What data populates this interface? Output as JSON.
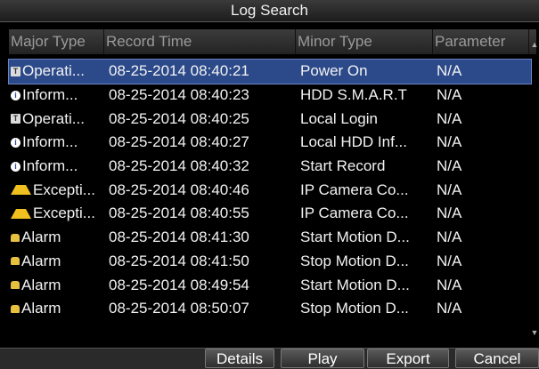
{
  "window": {
    "title": "Log Search"
  },
  "table": {
    "headers": [
      "Major Type",
      "Record Time",
      "Minor Type",
      "Parameter"
    ],
    "rows": [
      {
        "icon": "operation-icon",
        "major": "Operati...",
        "time": "08-25-2014 08:40:21",
        "minor": "Power On",
        "param": "N/A",
        "selected": true
      },
      {
        "icon": "information-icon",
        "major": "Inform...",
        "time": "08-25-2014 08:40:23",
        "minor": "HDD S.M.A.R.T",
        "param": "N/A"
      },
      {
        "icon": "operation-icon",
        "major": "Operati...",
        "time": "08-25-2014 08:40:25",
        "minor": "Local Login",
        "param": "N/A"
      },
      {
        "icon": "information-icon",
        "major": "Inform...",
        "time": "08-25-2014 08:40:27",
        "minor": "Local HDD Inf...",
        "param": "N/A"
      },
      {
        "icon": "information-icon",
        "major": "Inform...",
        "time": "08-25-2014 08:40:32",
        "minor": "Start Record",
        "param": "N/A"
      },
      {
        "icon": "exception-icon",
        "major": "Excepti...",
        "time": "08-25-2014 08:40:46",
        "minor": "IP Camera Co...",
        "param": "N/A"
      },
      {
        "icon": "exception-icon",
        "major": "Excepti...",
        "time": "08-25-2014 08:40:55",
        "minor": "IP Camera Co...",
        "param": "N/A"
      },
      {
        "icon": "alarm-icon",
        "major": "Alarm",
        "time": "08-25-2014 08:41:30",
        "minor": "Start Motion D...",
        "param": "N/A"
      },
      {
        "icon": "alarm-icon",
        "major": "Alarm",
        "time": "08-25-2014 08:41:50",
        "minor": "Stop Motion D...",
        "param": "N/A"
      },
      {
        "icon": "alarm-icon",
        "major": "Alarm",
        "time": "08-25-2014 08:49:54",
        "minor": "Start Motion D...",
        "param": "N/A"
      },
      {
        "icon": "alarm-icon",
        "major": "Alarm",
        "time": "08-25-2014 08:50:07",
        "minor": "Stop Motion D...",
        "param": "N/A"
      }
    ]
  },
  "buttons": {
    "details": "Details",
    "play": "Play",
    "export": "Export",
    "cancel": "Cancel"
  },
  "colors": {
    "selected_row": "#2c4a8a",
    "header_text": "#9a9a9a"
  }
}
